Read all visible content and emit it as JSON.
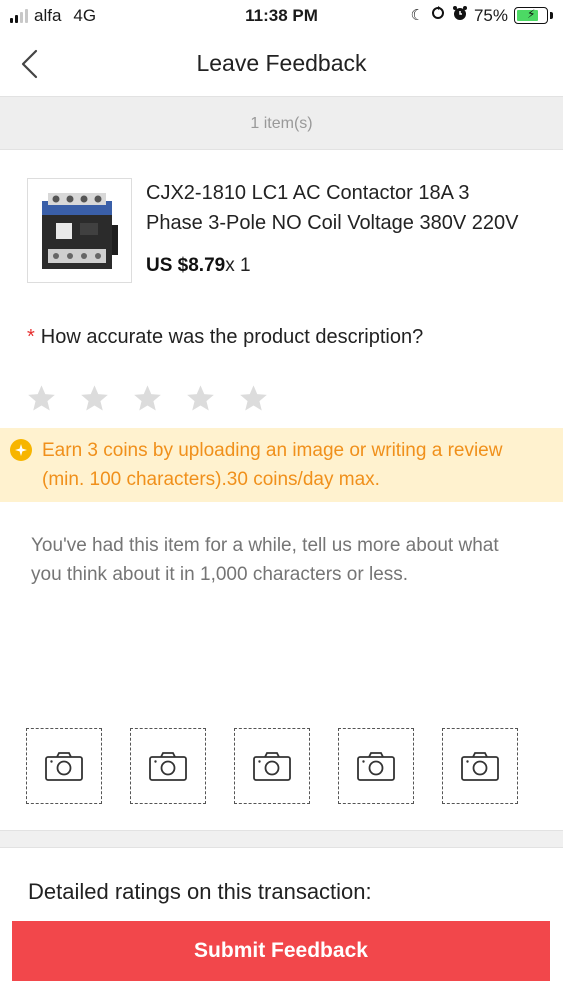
{
  "status_bar": {
    "carrier": "alfa",
    "network": "4G",
    "time": "11:38 PM",
    "battery": "75%",
    "battery_level": 0.75,
    "icons": [
      "moon-icon",
      "orientation-lock-icon",
      "alarm-icon"
    ]
  },
  "nav": {
    "title": "Leave Feedback",
    "back_icon": "chevron-left-icon"
  },
  "items_count": "1 item(s)",
  "product": {
    "title_line1": "CJX2-1810 LC1 AC Contactor 18A 3",
    "title_line2": "Phase 3-Pole NO Coil Voltage 380V 220V",
    "price": "US $8.79",
    "quantity": "x 1"
  },
  "question": {
    "required_mark": "*",
    "text": "How accurate was the product description?",
    "rating": 0,
    "max_rating": 5
  },
  "coin_banner": {
    "text": "Earn 3 coins by uploading an image or writing a review (min. 100 characters).30 coins/day max.",
    "color": "#f0901b",
    "background": "#fff2cf"
  },
  "review": {
    "placeholder": "You've had this item for a while, tell us more about what you think about it in 1,000 characters or less.",
    "value": ""
  },
  "photos": {
    "slot_count": 5,
    "icon": "camera-icon"
  },
  "detailed_ratings_label": "Detailed ratings on this transaction:",
  "submit": {
    "label": "Submit Feedback",
    "color": "#f2474b"
  }
}
